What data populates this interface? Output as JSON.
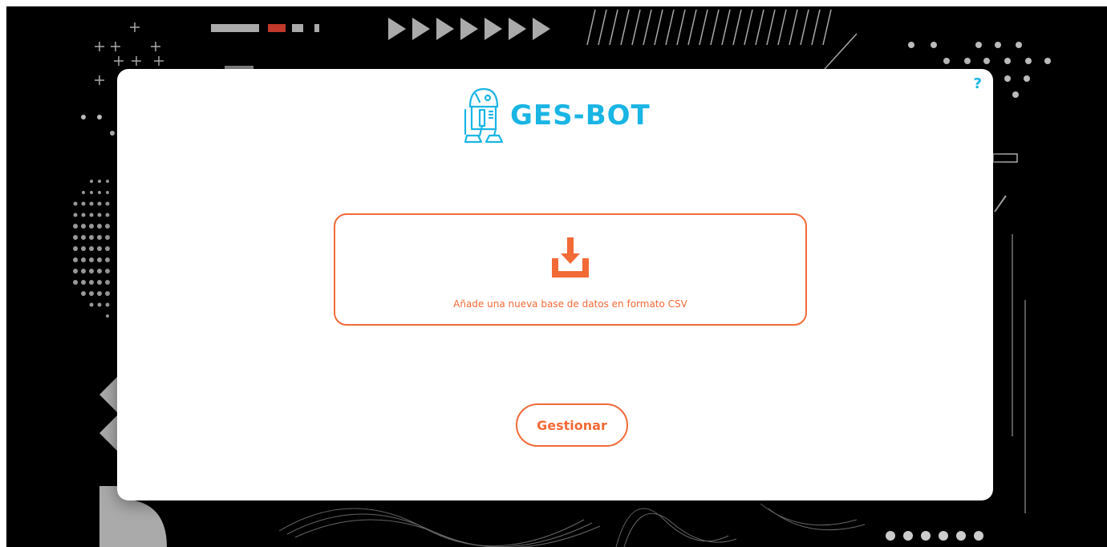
{
  "app": {
    "name": "GES-BOT"
  },
  "help": {
    "label": "?"
  },
  "upload": {
    "label": "Añade una nueva base de datos en formato CSV",
    "icon": "download-icon"
  },
  "actions": {
    "manage_label": "Gestionar"
  },
  "colors": {
    "accent_orange": "#f26a36",
    "brand_blue": "#19b5e4",
    "background": "#000000",
    "modal": "#ffffff"
  }
}
